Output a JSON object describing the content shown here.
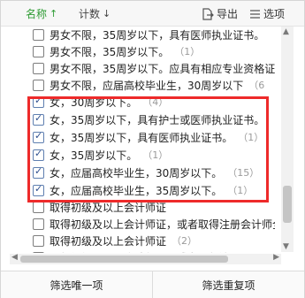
{
  "toolbar": {
    "name_label": "名称",
    "name_arrow": "↑",
    "count_label": "计数",
    "count_arrow": "↓",
    "export_label": "导出",
    "options_label": "选项"
  },
  "rows": [
    {
      "text": "男女不限，35周岁以下，具有医师执业证书。",
      "count": "（1",
      "checked": false
    },
    {
      "text": "男女不限，35周岁以下。",
      "count": "（1）",
      "checked": false
    },
    {
      "text": "男女不限，35周岁以下。应具有相应专业资格证书",
      "count": "",
      "checked": false
    },
    {
      "text": "男女不限，应届高校毕业生，30周岁以下",
      "count": "（6",
      "checked": false
    },
    {
      "text": "女，30周岁以下。",
      "count": "（4）",
      "checked": true
    },
    {
      "text": "女，35周岁以下，具有护士或医师执业证书。",
      "count": "（1）",
      "checked": true
    },
    {
      "text": "女，35周岁以下，具有医师执业证书。",
      "count": "（1）",
      "checked": true
    },
    {
      "text": "女，35周岁以下。",
      "count": "（1）",
      "checked": true
    },
    {
      "text": "女，应届高校毕业生，30周岁以下。",
      "count": "（15）",
      "checked": true
    },
    {
      "text": "女，应届高校毕业生，35周岁以下。",
      "count": "（1）",
      "checked": true
    },
    {
      "text": "取得初级及以上会计师证",
      "count": "",
      "checked": false
    },
    {
      "text": "取得初级及以上会计师证，或者取得注册会计师全",
      "count": "",
      "checked": false
    },
    {
      "text": "取得初级及以上会计师证",
      "count": "（2）",
      "checked": false
    },
    {
      "text": "取得初级及以上会计师证，或者取得注册",
      "count": "",
      "checked": false
    }
  ],
  "bottom": {
    "unique_label": "筛选唯一项",
    "duplicate_label": "筛选重复项"
  },
  "colors": {
    "accent_green": "#2e9b33",
    "highlight_red": "#ee2a2a"
  }
}
